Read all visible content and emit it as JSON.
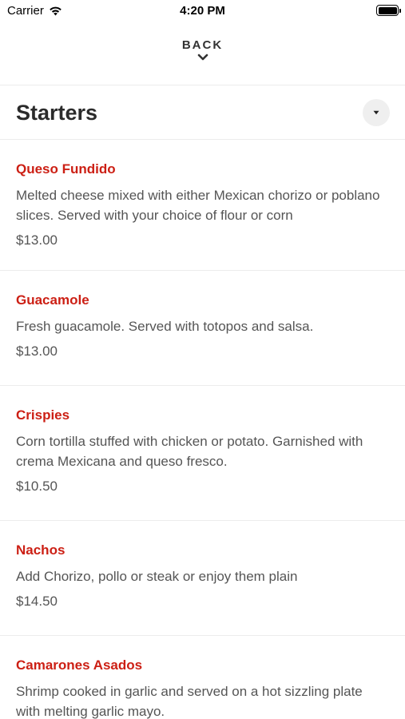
{
  "status_bar": {
    "carrier": "Carrier",
    "time": "4:20 PM",
    "wifi_icon": "wifi-icon",
    "battery_icon": "battery-icon"
  },
  "header": {
    "back_label": "BACK",
    "back_icon": "chevron-down-icon"
  },
  "section": {
    "title": "Starters",
    "toggle_icon": "caret-down-icon"
  },
  "menu_items": [
    {
      "name": "Queso Fundido",
      "description": "Melted cheese mixed with either Mexican chorizo or poblano slices. Served with your choice of flour or corn",
      "price": "$13.00"
    },
    {
      "name": "Guacamole",
      "description": "Fresh guacamole. Served with totopos and salsa.",
      "price": "$13.00"
    },
    {
      "name": "Crispies",
      "description": "Corn tortilla stuffed with chicken or potato. Garnished with crema Mexicana and queso fresco.",
      "price": "$10.50"
    },
    {
      "name": "Nachos",
      "description": "Add Chorizo, pollo or steak or enjoy them plain",
      "price": "$14.50"
    },
    {
      "name": "Camarones Asados",
      "description": "Shrimp cooked in garlic and served on a hot sizzling plate with melting garlic mayo.",
      "price": ""
    }
  ],
  "colors": {
    "item_name": "#cc1f14",
    "text": "#555555",
    "divider": "#ececec"
  }
}
